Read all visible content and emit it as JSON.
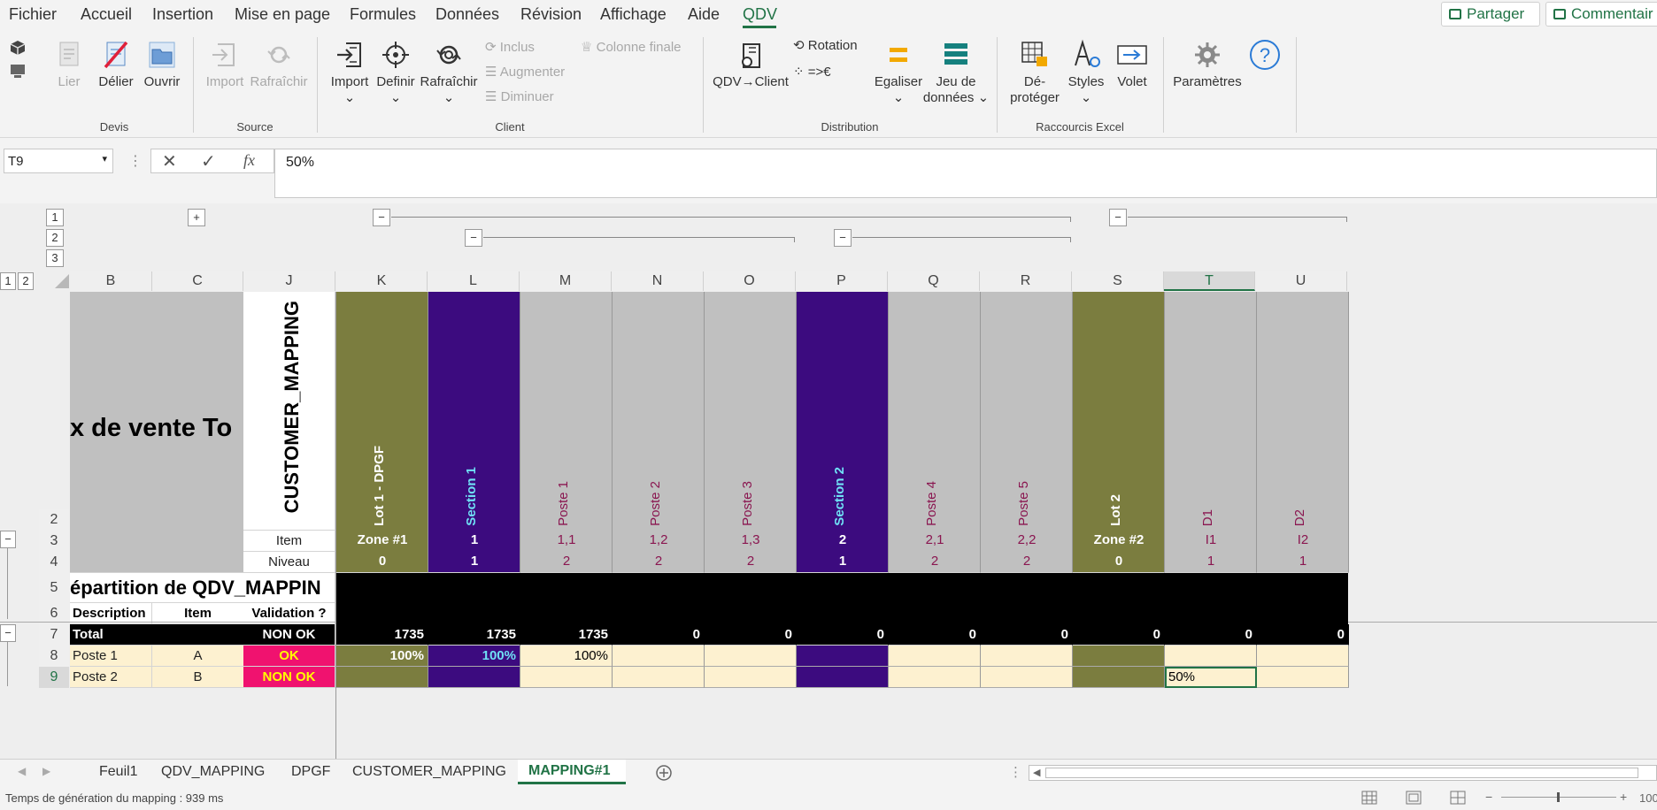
{
  "menu": {
    "items": [
      "Fichier",
      "Accueil",
      "Insertion",
      "Mise en page",
      "Formules",
      "Données",
      "Révision",
      "Affichage",
      "Aide",
      "QDV"
    ],
    "share_label": "Partager",
    "comments_label": "Commentair"
  },
  "ribbon": {
    "devis": {
      "group": "Devis",
      "lier": "Lier",
      "delier": "Délier",
      "ouvrir": "Ouvrir"
    },
    "source": {
      "group": "Source",
      "import": "Import",
      "rafraichir": "Rafraîchir"
    },
    "client": {
      "group": "Client",
      "import": "Import",
      "definir": "Definir",
      "rafraichir": "Rafraîchir",
      "inclus": "Inclus",
      "augmenter": "Augmenter",
      "diminuer": "Diminuer",
      "colonne_finale": "Colonne finale"
    },
    "distribution": {
      "group": "Distribution",
      "qdv_client": "QDV→Client",
      "rotation": "Rotation",
      "euro": "=>€",
      "egaliser": "Egaliser",
      "jeu1": "Jeu de",
      "jeu2": "données"
    },
    "raccourcis": {
      "group": "Raccourcis Excel",
      "deprot1": "Dé-",
      "deprot2": "protéger",
      "styles": "Styles",
      "volet": "Volet"
    },
    "parametres": "Paramètres"
  },
  "formula": {
    "namebox": "T9",
    "value": "50%"
  },
  "columns": [
    "B",
    "C",
    "J",
    "K",
    "L",
    "M",
    "N",
    "O",
    "P",
    "Q",
    "R",
    "S",
    "T",
    "U"
  ],
  "rows": [
    "2",
    "3",
    "4",
    "5",
    "6",
    "7",
    "8",
    "9"
  ],
  "outline": {
    "levels_top": [
      "1",
      "2",
      "3"
    ],
    "levels_left": [
      "1",
      "2"
    ]
  },
  "sheet": {
    "title_fragment": "x de vente To",
    "customer_mapping": "CUSTOMER_MAPPING",
    "item_label": "Item",
    "niveau_label": "Niveau",
    "repartition": "épartition de QDV_MAPPIN",
    "hdr_description": "Description",
    "hdr_item": "Item",
    "hdr_validation": "Validation ?",
    "total_label": "Total",
    "total_status": "NON OK",
    "poste1": {
      "desc": "Poste 1",
      "item": "A",
      "status": "OK"
    },
    "poste2": {
      "desc": "Poste 2",
      "item": "B",
      "status": "NON OK"
    },
    "cols": [
      {
        "name": "Lot 1 - DPGF",
        "item": "Zone #1",
        "niveau": "0",
        "total": "1735",
        "r8": "100%",
        "r9": ""
      },
      {
        "name": "Section 1",
        "item": "1",
        "niveau": "1",
        "total": "1735",
        "r8": "100%",
        "r9": ""
      },
      {
        "name": "Poste 1",
        "item": "1,1",
        "niveau": "2",
        "total": "1735",
        "r8": "100%",
        "r9": ""
      },
      {
        "name": "Poste 2",
        "item": "1,2",
        "niveau": "2",
        "total": "0",
        "r8": "",
        "r9": ""
      },
      {
        "name": "Poste 3",
        "item": "1,3",
        "niveau": "2",
        "total": "0",
        "r8": "",
        "r9": ""
      },
      {
        "name": "Section 2",
        "item": "2",
        "niveau": "1",
        "total": "0",
        "r8": "",
        "r9": ""
      },
      {
        "name": "Poste 4",
        "item": "2,1",
        "niveau": "2",
        "total": "0",
        "r8": "",
        "r9": ""
      },
      {
        "name": "Poste 5",
        "item": "2,2",
        "niveau": "2",
        "total": "0",
        "r8": "",
        "r9": ""
      },
      {
        "name": "Lot 2",
        "item": "Zone #2",
        "niveau": "0",
        "total": "0",
        "r8": "",
        "r9": ""
      },
      {
        "name": "D1",
        "item": "I1",
        "niveau": "1",
        "total": "0",
        "r8": "",
        "r9": "50%"
      },
      {
        "name": "D2",
        "item": "I2",
        "niveau": "1",
        "total": "0",
        "r8": "",
        "r9": ""
      }
    ]
  },
  "tabs": [
    "Feuil1",
    "QDV_MAPPING",
    "DPGF",
    "CUSTOMER_MAPPING",
    "MAPPING#1"
  ],
  "active_tab": "MAPPING#1",
  "status": {
    "text": "Temps de génération du mapping : 939 ms",
    "zoom": "100"
  },
  "colors": {
    "olive": "#7b7d3f",
    "purple": "#3c0b7f",
    "grey": "#c0c0c0",
    "cream": "#fdf1d0",
    "pink": "#f0126f",
    "accent": "#217346"
  }
}
